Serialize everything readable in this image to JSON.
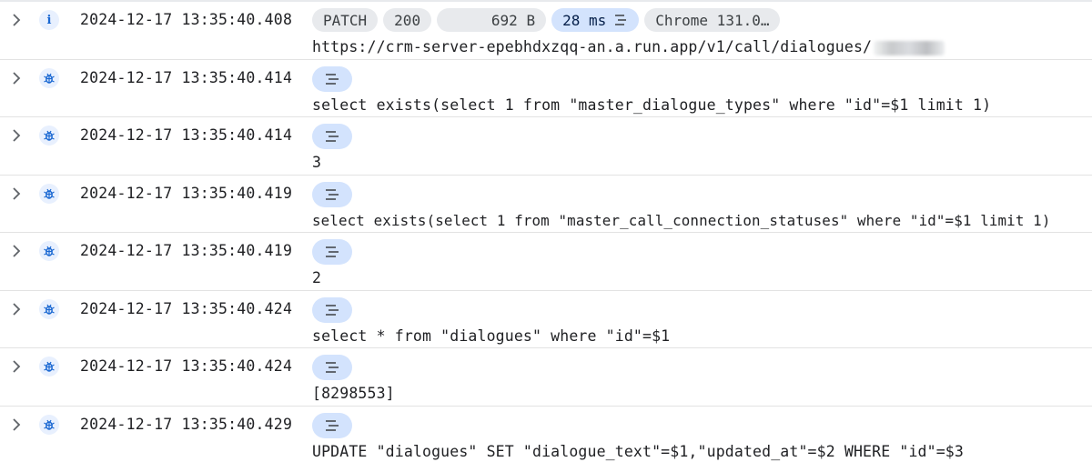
{
  "colors": {
    "debug_icon": "#1967d2",
    "chip_blue": "#d3e3fd",
    "chip_grey": "#e8eaed",
    "row_border": "#e3e3e3"
  },
  "rows": [
    {
      "severity": "info",
      "severity_icon": "info-icon",
      "timestamp": "2024-12-17 13:35:40.408",
      "chips": {
        "method": "PATCH",
        "status": "200",
        "size": "692 B",
        "latency": "28 ms",
        "agent": "Chrome 131.0…"
      },
      "text": "https://crm-server-epebhdxzqq-an.a.run.app/v1/call/dialogues/"
    },
    {
      "severity": "debug",
      "severity_icon": "bug-icon",
      "timestamp": "2024-12-17 13:35:40.414",
      "text": "select exists(select 1 from \"master_dialogue_types\" where \"id\"=$1 limit 1)"
    },
    {
      "severity": "debug",
      "severity_icon": "bug-icon",
      "timestamp": "2024-12-17 13:35:40.414",
      "text": "3"
    },
    {
      "severity": "debug",
      "severity_icon": "bug-icon",
      "timestamp": "2024-12-17 13:35:40.419",
      "text": "select exists(select 1 from \"master_call_connection_statuses\" where \"id\"=$1 limit 1)"
    },
    {
      "severity": "debug",
      "severity_icon": "bug-icon",
      "timestamp": "2024-12-17 13:35:40.419",
      "text": "2"
    },
    {
      "severity": "debug",
      "severity_icon": "bug-icon",
      "timestamp": "2024-12-17 13:35:40.424",
      "text": "select * from \"dialogues\" where \"id\"=$1"
    },
    {
      "severity": "debug",
      "severity_icon": "bug-icon",
      "timestamp": "2024-12-17 13:35:40.424",
      "text": "[8298553]"
    },
    {
      "severity": "debug",
      "severity_icon": "bug-icon",
      "timestamp": "2024-12-17 13:35:40.429",
      "text": "UPDATE \"dialogues\" SET \"dialogue_text\"=$1,\"updated_at\"=$2 WHERE \"id\"=$3"
    }
  ]
}
